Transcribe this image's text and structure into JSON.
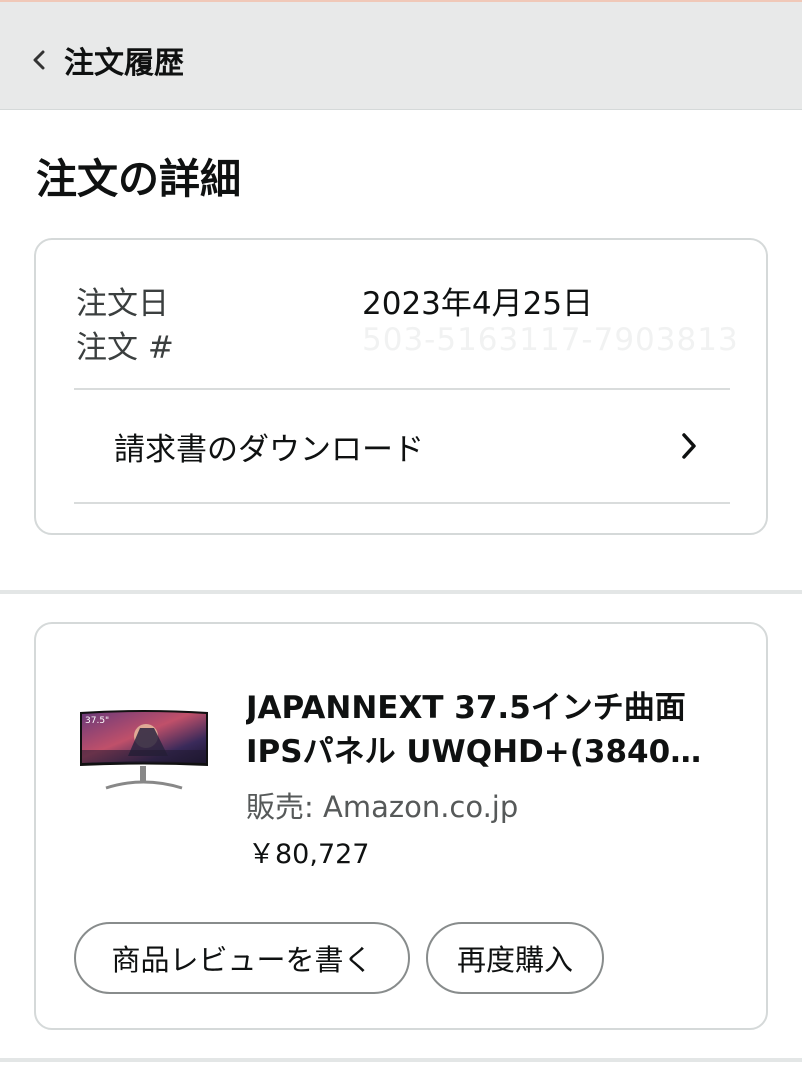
{
  "header": {
    "back_label": "注文履歴"
  },
  "page": {
    "title": "注文の詳細"
  },
  "order_summary": {
    "date_label": "注文日",
    "date_value": "2023年4月25日",
    "number_label": "注文 #",
    "number_value": "503-5163117-7903813",
    "download_label": "請求書のダウンロード"
  },
  "item": {
    "title_line1": "JAPANNEXT 37.5インチ曲面",
    "title_line2": "IPSパネル UWQHD+(3840…",
    "seller": "販売: Amazon.co.jp",
    "price": "￥80,727",
    "thumb_badge": "37.5\"",
    "review_button": "商品レビューを書く",
    "rebuy_button": "再度購入"
  },
  "icons": {
    "back": "chevron-left-icon",
    "download_chevron": "chevron-right-icon"
  },
  "colors": {
    "header_bg": "#e8e9e9",
    "card_border": "#d5d9d9",
    "pill_border": "#888c8c",
    "text_primary": "#0f1111",
    "text_secondary": "#565959"
  }
}
